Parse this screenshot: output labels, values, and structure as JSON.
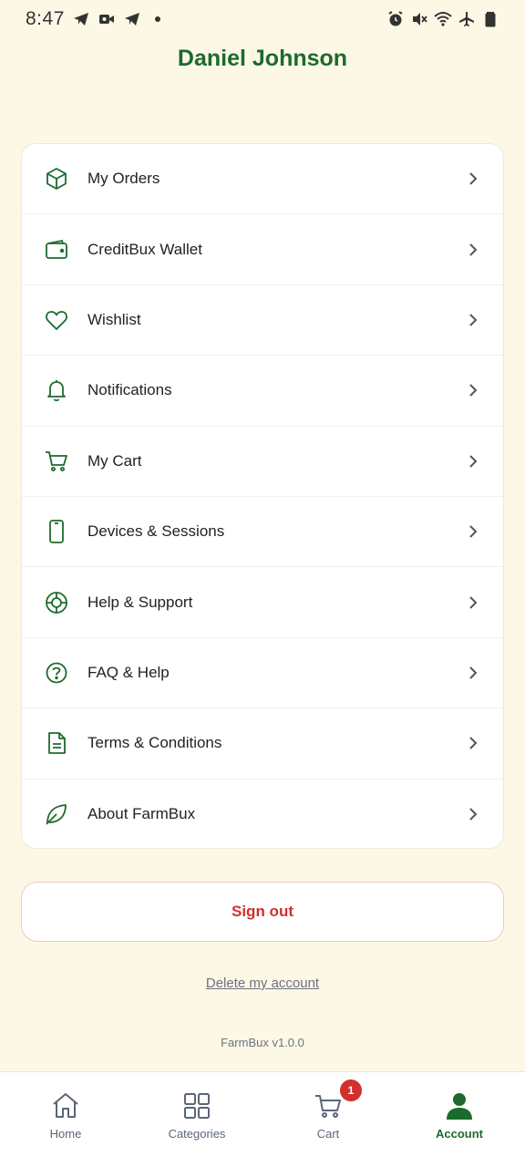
{
  "status_bar": {
    "time": "8:47",
    "left_icons": [
      "telegram-icon",
      "video-icon",
      "telegram-icon",
      "dot-icon"
    ],
    "right_icons": [
      "alarm-icon",
      "mute-icon",
      "wifi-icon",
      "airplane-icon",
      "battery-icon"
    ]
  },
  "profile": {
    "name": "Daniel Johnson"
  },
  "menu": {
    "items": [
      {
        "label": "My Orders",
        "icon": "box-icon"
      },
      {
        "label": "CreditBux Wallet",
        "icon": "wallet-icon"
      },
      {
        "label": "Wishlist",
        "icon": "heart-icon"
      },
      {
        "label": "Notifications",
        "icon": "bell-icon"
      },
      {
        "label": "My Cart",
        "icon": "cart-icon"
      },
      {
        "label": "Devices & Sessions",
        "icon": "phone-icon"
      },
      {
        "label": "Help & Support",
        "icon": "lifebuoy-icon"
      },
      {
        "label": "FAQ & Help",
        "icon": "question-icon"
      },
      {
        "label": "Terms & Conditions",
        "icon": "document-icon"
      },
      {
        "label": "About FarmBux",
        "icon": "leaf-icon"
      }
    ]
  },
  "actions": {
    "sign_out": "Sign out",
    "delete_account": "Delete my account"
  },
  "footer": {
    "version": "FarmBux v1.0.0"
  },
  "bottom_nav": {
    "items": [
      {
        "label": "Home",
        "icon": "home-icon"
      },
      {
        "label": "Categories",
        "icon": "grid-icon"
      },
      {
        "label": "Cart",
        "icon": "cart-icon",
        "badge": "1"
      },
      {
        "label": "Account",
        "icon": "person-icon",
        "active": true
      }
    ]
  },
  "colors": {
    "background": "#fdf8e6",
    "brand_green": "#1c6b2c",
    "danger_red": "#d32f2f",
    "nav_gray": "#5a6678"
  }
}
